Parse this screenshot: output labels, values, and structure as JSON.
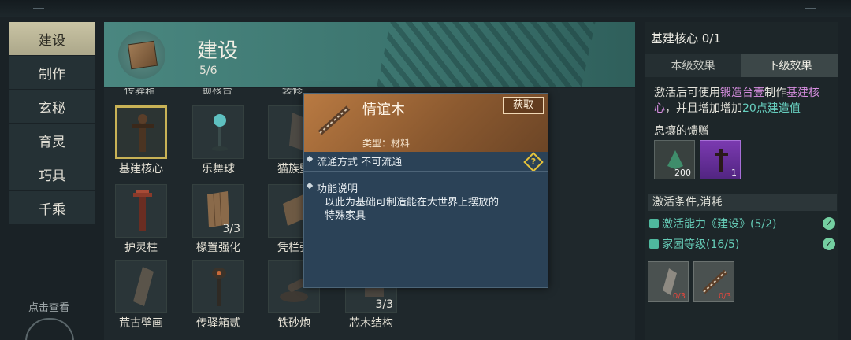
{
  "sidebar": {
    "items": [
      "建设",
      "制作",
      "玄秘",
      "育灵",
      "巧具",
      "千乘"
    ],
    "hint": "点击查看"
  },
  "banner": {
    "title": "建设",
    "count": "5/6"
  },
  "grid": {
    "cut_labels": [
      "传驿箱",
      "锁核台",
      "装修"
    ],
    "items": [
      {
        "label": "基建核心",
        "qty": ""
      },
      {
        "label": "乐舞球",
        "qty": ""
      },
      {
        "label": "猫族壁",
        "qty": ""
      },
      {
        "label": "护灵柱",
        "qty": ""
      },
      {
        "label": "椽置强化",
        "qty": "3/3"
      },
      {
        "label": "凭栏强",
        "qty": ""
      },
      {
        "label": "荒古壁画",
        "qty": ""
      },
      {
        "label": "传驿箱贰",
        "qty": ""
      },
      {
        "label": "铁砂炮",
        "qty": ""
      },
      {
        "label": "芯木结构",
        "qty": "3/3"
      }
    ]
  },
  "tooltip": {
    "title": "情谊木",
    "get_label": "获取",
    "type": "类型：材料",
    "circulation": "流通方式   不可流通",
    "warn_glyph": "?",
    "func_title": "功能说明",
    "func_desc_1": "以此为基础可制造能在大世界上摆放的",
    "func_desc_2": "特殊家具"
  },
  "panel": {
    "title": "基建核心 0/1",
    "tabs": [
      "本级效果",
      "下级效果"
    ],
    "desc": {
      "p1": "激活后可使用",
      "h1": "锻造台壹",
      "p2": "制作",
      "h2": "基建核心",
      "p3": "，并且增加增加",
      "h3": "20点建造值"
    },
    "reward_title": "息壤的馈赠",
    "rewards": [
      {
        "count": "200"
      },
      {
        "count": "1"
      }
    ],
    "cond_title": "激活条件,消耗",
    "conditions": [
      {
        "text": "激活能力《建设》(5/2)"
      },
      {
        "text": "家园等级(16/5)"
      }
    ],
    "costs": [
      {
        "count": "0/3"
      },
      {
        "count": "0/3"
      }
    ],
    "check_glyph": "✓"
  },
  "colors": {
    "accent_gold": "#c8b256",
    "highlight_pink": "#d78ee0",
    "highlight_green": "#67cfbf",
    "cost_red": "#e9463c",
    "tooltip_bg": "#2b4257"
  }
}
